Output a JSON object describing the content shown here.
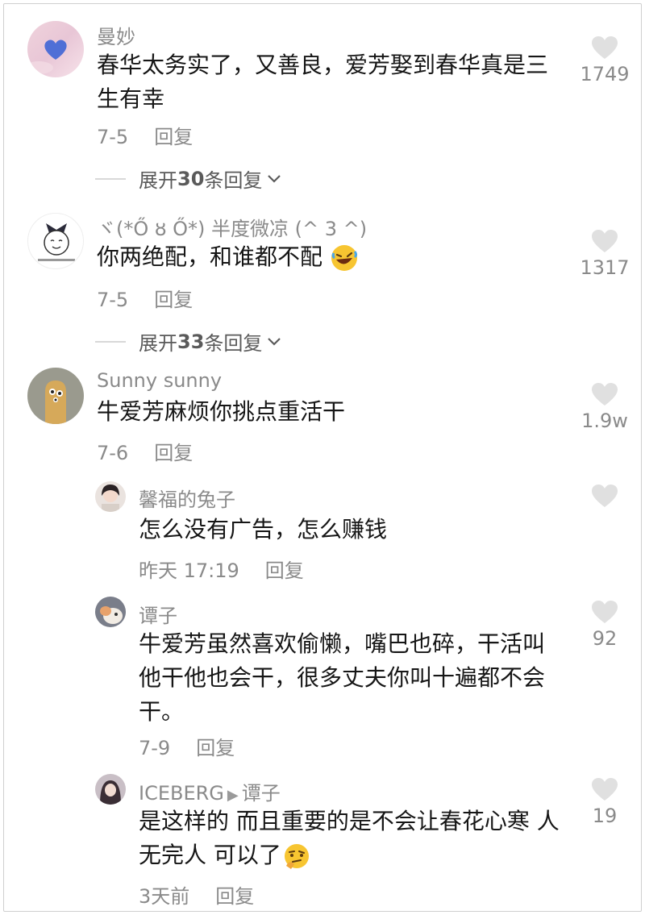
{
  "comments": [
    {
      "user": "曼妙",
      "text_lines": [
        "春华太务实了，又善良，爱芳娶到春华真是三",
        "生有幸"
      ],
      "date": "7-5",
      "reply_label": "回复",
      "likes": "1749",
      "expand": {
        "prefix": "展开",
        "count": "30",
        "suffix": "条回复"
      }
    },
    {
      "user": "ヾ(*Ő ȣ Ő*) 半度微凉 (^ 3 ^)",
      "text": "你两绝配，和谁都不配",
      "emoji": "rofl-emoji",
      "date": "7-5",
      "reply_label": "回复",
      "likes": "1317",
      "expand": {
        "prefix": "展开",
        "count": "33",
        "suffix": "条回复"
      }
    },
    {
      "user": "Sunny sunny",
      "text": "牛爱芳麻烦你挑点重活干",
      "date": "7-6",
      "reply_label": "回复",
      "likes": "1.9w",
      "replies": [
        {
          "user": "馨福的兔子",
          "text": "怎么没有广告，怎么赚钱",
          "date": "昨天 17:19",
          "reply_label": "回复",
          "likes": ""
        },
        {
          "user": "谭子",
          "text_lines": [
            "牛爱芳虽然喜欢偷懒，嘴巴也碎，干活叫",
            "他干他也会干，很多丈夫你叫十遍都不会",
            "干。"
          ],
          "date": "7-9",
          "reply_label": "回复",
          "likes": "92"
        },
        {
          "user": "ICEBERG",
          "reply_to": "谭子",
          "text_lines": [
            "是这样的 而且重要的是不会让春花心寒 人",
            "无完人 可以了"
          ],
          "emoji": "thinking-emoji",
          "date": "3天前",
          "reply_label": "回复",
          "likes": "19"
        }
      ]
    }
  ],
  "colors": {
    "meta": "#8a8a8a",
    "heart": "#e0e0e0",
    "text": "#161616"
  }
}
